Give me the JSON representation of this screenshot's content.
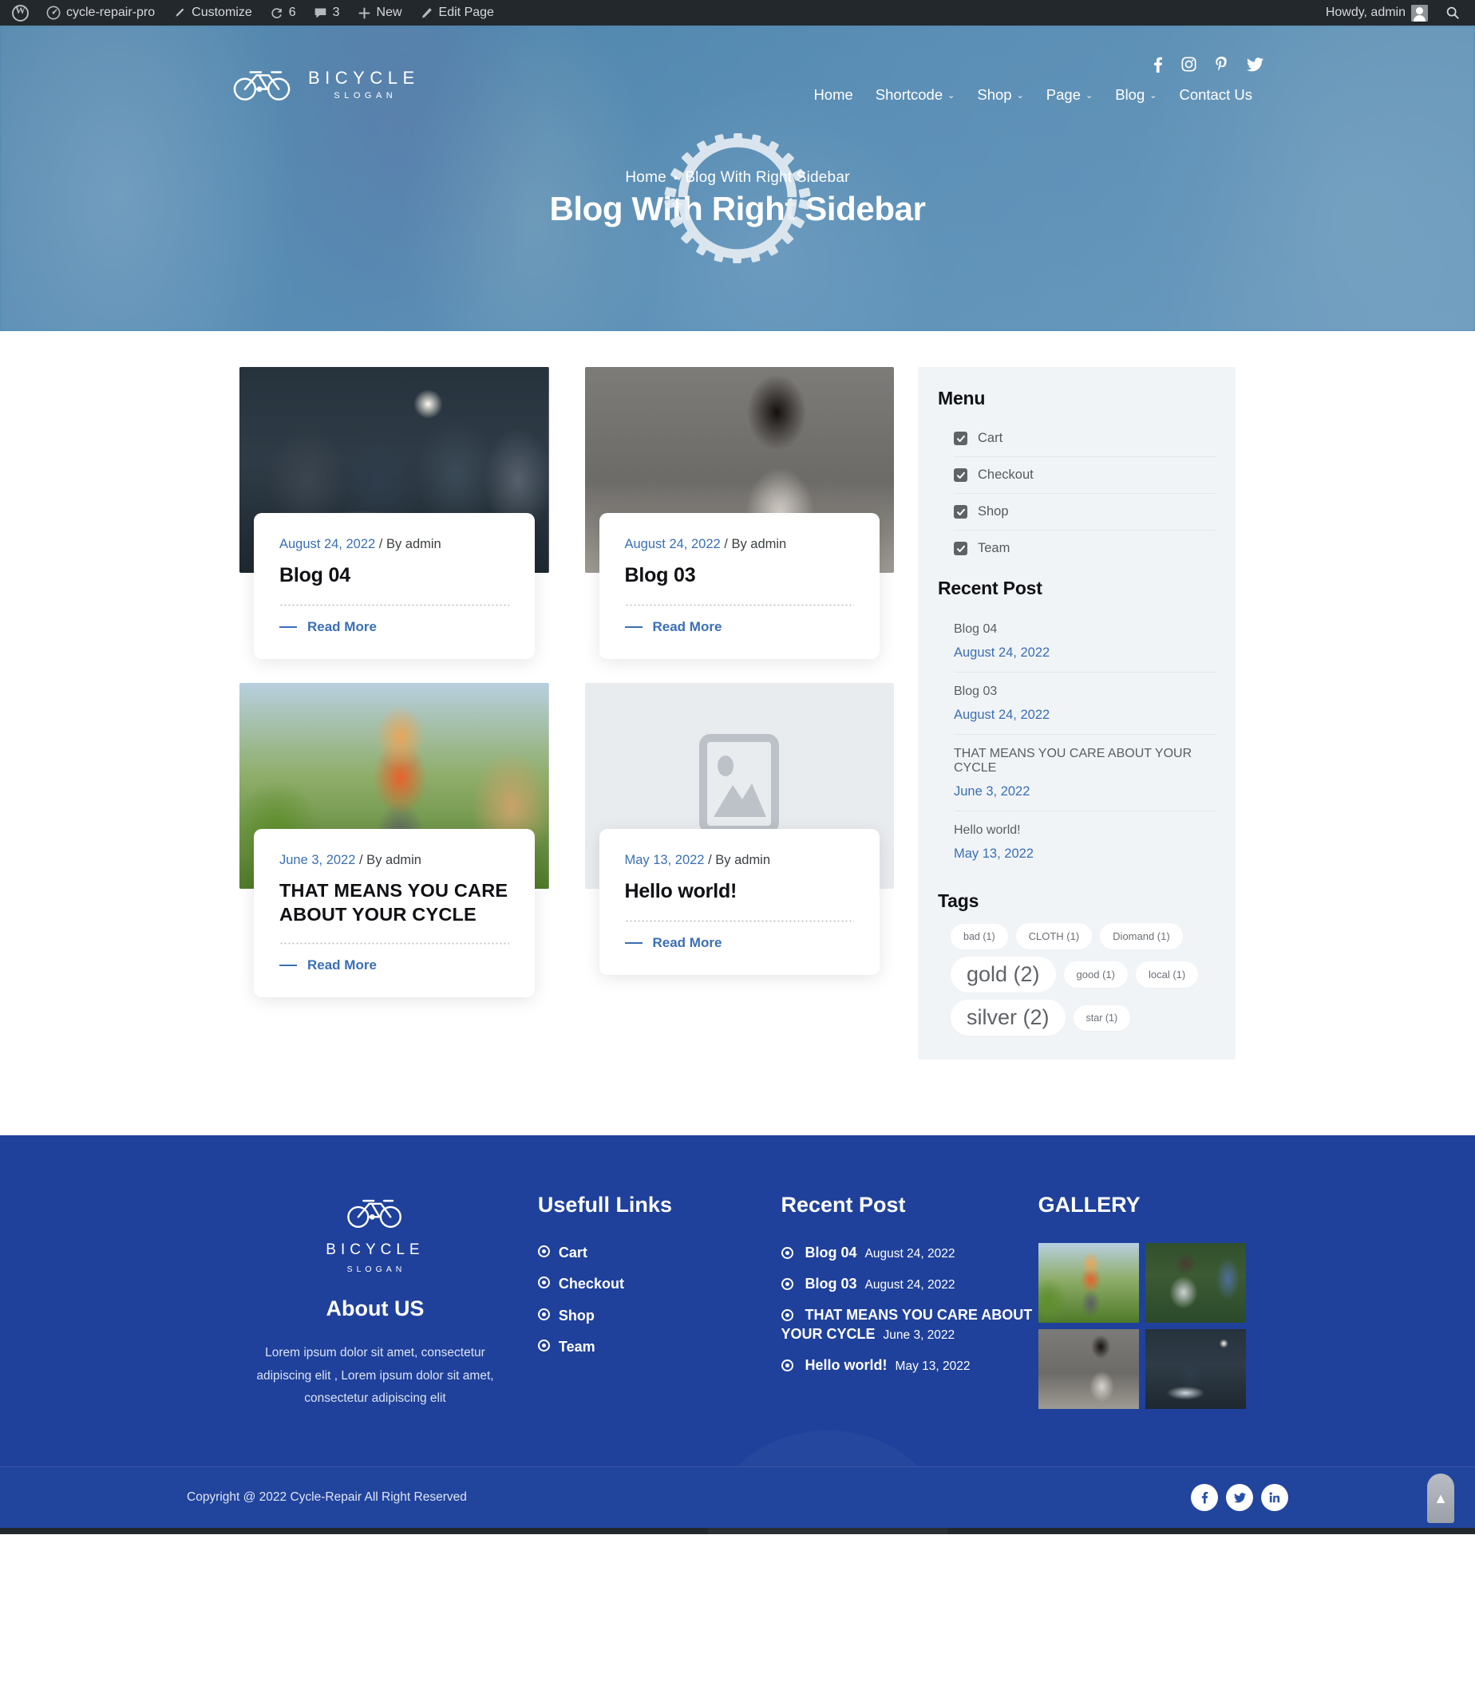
{
  "adminbar": {
    "site_name": "cycle-repair-pro",
    "customize": "Customize",
    "updates_count": "6",
    "comments_count": "3",
    "new": "New",
    "edit_page": "Edit Page",
    "howdy": "Howdy, admin"
  },
  "header": {
    "logo_title": "BICYCLE",
    "logo_sub": "SLOGAN",
    "social": [
      "facebook-icon",
      "instagram-icon",
      "pinterest-icon",
      "twitter-icon"
    ],
    "nav": [
      {
        "label": "Home",
        "has_dropdown": false
      },
      {
        "label": "Shortcode",
        "has_dropdown": true
      },
      {
        "label": "Shop",
        "has_dropdown": true
      },
      {
        "label": "Page",
        "has_dropdown": true
      },
      {
        "label": "Blog",
        "has_dropdown": true
      },
      {
        "label": "Contact Us",
        "has_dropdown": false
      }
    ]
  },
  "hero": {
    "breadcrumb_home": "Home",
    "breadcrumb_sep": "•",
    "breadcrumb_current": "Blog With Right Sidebar",
    "title": "Blog With Right Sidebar"
  },
  "posts": [
    {
      "date": "August 24, 2022",
      "author": "/ By admin",
      "title": "Blog 04",
      "read_more": "Read More",
      "image": "meeting-room-team",
      "caps": false
    },
    {
      "date": "August 24, 2022",
      "author": "/ By admin",
      "title": "Blog 03",
      "read_more": "Read More",
      "image": "woman-laptop-desk",
      "caps": false
    },
    {
      "date": "June 3, 2022",
      "author": "/ By admin",
      "title": "THAT MEANS YOU CARE ABOUT YOUR CYCLE",
      "read_more": "Read More",
      "image": "gardener-hedge-trimmer",
      "caps": true
    },
    {
      "date": "May 13, 2022",
      "author": "/ By admin",
      "title": "Hello world!",
      "read_more": "Read More",
      "image": "placeholder-image-icon",
      "caps": false
    }
  ],
  "sidebar": {
    "menu_title": "Menu",
    "menu_items": [
      "Cart",
      "Checkout",
      "Shop",
      "Team"
    ],
    "recent_title": "Recent Post",
    "recent_items": [
      {
        "name": "Blog 04",
        "date": "August 24, 2022"
      },
      {
        "name": "Blog 03",
        "date": "August 24, 2022"
      },
      {
        "name": "THAT MEANS YOU CARE ABOUT YOUR CYCLE",
        "date": "June 3, 2022"
      },
      {
        "name": "Hello world!",
        "date": "May 13, 2022"
      }
    ],
    "tags_title": "Tags",
    "tags": [
      {
        "label": "bad (1)",
        "size": "s1"
      },
      {
        "label": "CLOTH (1)",
        "size": "s2"
      },
      {
        "label": "Diomand (1)",
        "size": "s2"
      },
      {
        "label": "gold (2)",
        "size": "s3"
      },
      {
        "label": "good (1)",
        "size": "s2"
      },
      {
        "label": "local (1)",
        "size": "s2"
      },
      {
        "label": "silver (2)",
        "size": "s3"
      },
      {
        "label": "star (1)",
        "size": "s1"
      }
    ]
  },
  "footer": {
    "logo_title": "BICYCLE",
    "logo_sub": "SLOGAN",
    "about_heading": "About US",
    "about_text": "Lorem ipsum dolor sit amet, consectetur adipiscing elit , Lorem ipsum dolor sit amet, consectetur adipiscing elit",
    "links_heading": "Usefull Links",
    "links": [
      "Cart",
      "Checkout",
      "Shop",
      "Team"
    ],
    "recent_heading": "Recent Post",
    "recent": [
      {
        "title": "Blog 04",
        "date": "August 24, 2022"
      },
      {
        "title": "Blog 03",
        "date": "August 24, 2022"
      },
      {
        "title": "THAT MEANS YOU CARE ABOUT YOUR CYCLE",
        "date": "June 3, 2022"
      },
      {
        "title": "Hello world!",
        "date": "May 13, 2022"
      }
    ],
    "gallery_heading": "GALLERY",
    "gallery": [
      "gardener-hedge-trimmer",
      "man-repairing-bicycle",
      "woman-laptop-desk",
      "meeting-room-team"
    ],
    "copyright": "Copyright @ 2022 Cycle-Repair All Right Reserved",
    "social": [
      "facebook-icon",
      "twitter-icon",
      "linkedin-icon"
    ],
    "back_to_top": "▲"
  },
  "colors": {
    "admin_bar": "#23282d",
    "hero_overlay": "#5588b4",
    "link_blue": "#3a6fb5",
    "footer_blue": "#1f419b",
    "sidebar_bg": "#f1f4f7"
  }
}
